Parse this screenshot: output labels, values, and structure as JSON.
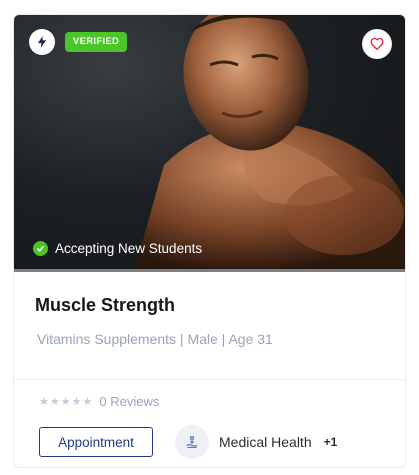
{
  "badge": {
    "verified_label": "VERIFIED"
  },
  "status": {
    "accepting_label": "Accepting New Students"
  },
  "title": "Muscle Strength",
  "meta": "Vitamins Supplements | Male | Age 31",
  "reviews": {
    "label": "0 Reviews",
    "stars_filled": 0,
    "stars_total": 5
  },
  "actions": {
    "appointment_label": "Appointment"
  },
  "specialty": {
    "label": "Medical Health",
    "more": "+1"
  },
  "icons": {
    "bolt": "lightning-bolt-icon",
    "heart": "heart-icon",
    "check": "check-circle-icon",
    "specialty": "health-icon",
    "star": "star-icon"
  },
  "colors": {
    "verified": "#4cc52a",
    "accent": "#1e3a8a",
    "heart": "#e0203a",
    "muted": "#9aa3b6"
  }
}
